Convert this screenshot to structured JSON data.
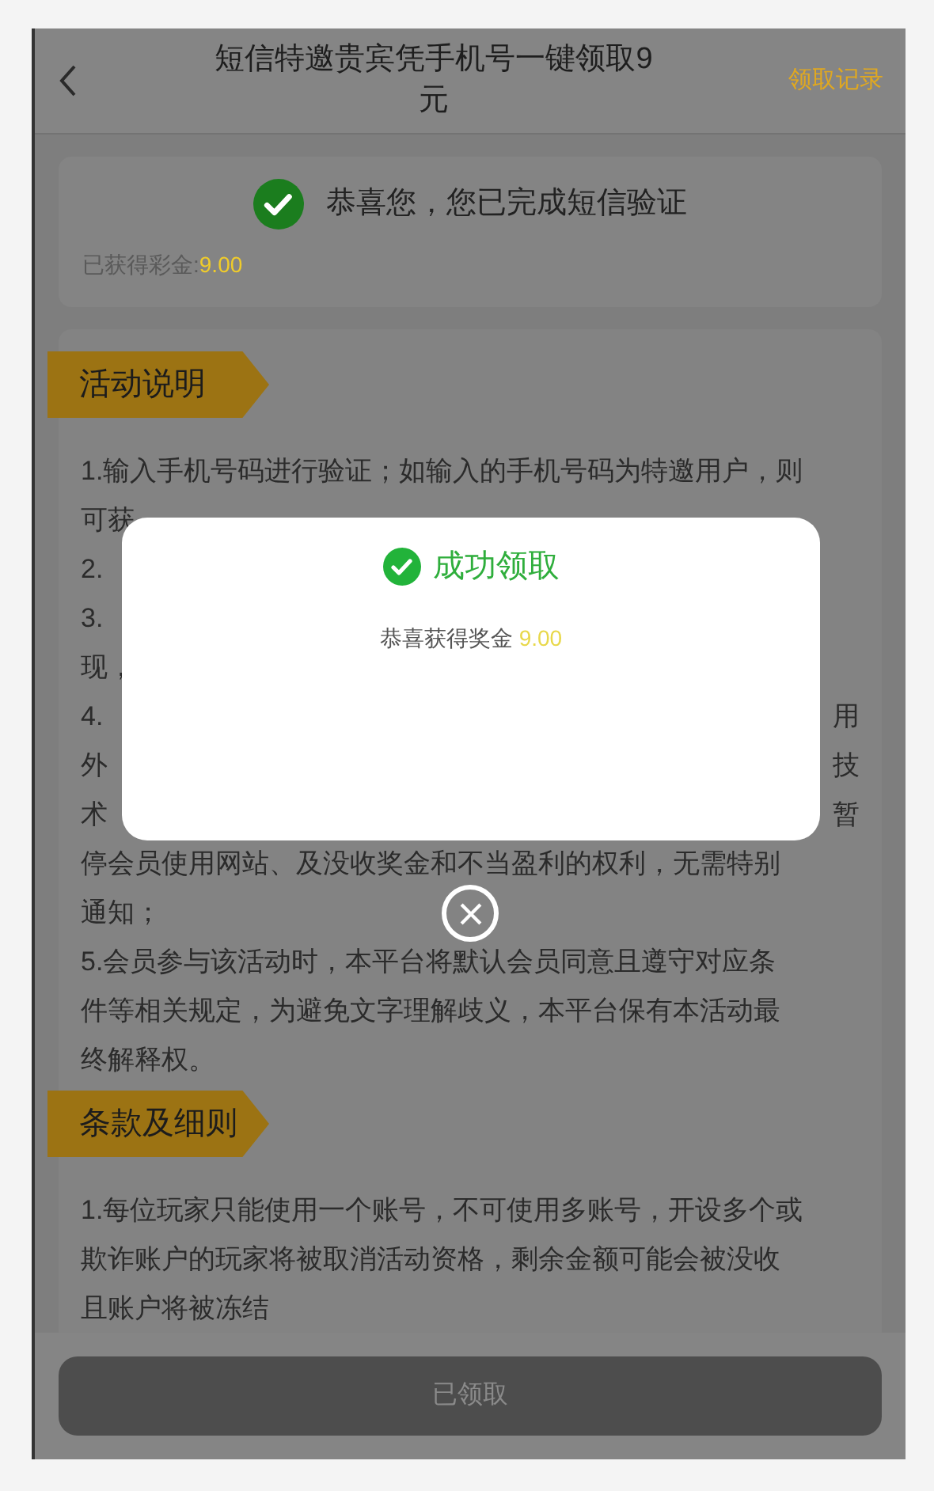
{
  "header": {
    "title": "短信特邀贵宾凭手机号一键领取9元",
    "action": "领取记录"
  },
  "status_card": {
    "message": "恭喜您，您已完成短信验证",
    "earned_label": "已获得彩金:",
    "earned_value": "9.00"
  },
  "sections": [
    {
      "title": "活动说明",
      "lines": [
        {
          "parts": [
            "1.输入手机号码进行验证；如输入的手机号码为特邀用户，则"
          ]
        },
        {
          "parts": [
            "可获"
          ]
        },
        {
          "parts": [
            "2."
          ]
        },
        {
          "parts": [
            "3."
          ]
        },
        {
          "parts": [
            "现，"
          ]
        },
        {
          "parts": [
            "4.",
            "用"
          ]
        },
        {
          "parts": [
            "外",
            "技"
          ]
        },
        {
          "parts": [
            "术",
            "暂"
          ]
        },
        {
          "parts": [
            "停会员使用网站、及没收奖金和不当盈利的权利，无需特别"
          ]
        },
        {
          "parts": [
            "通知；"
          ]
        },
        {
          "parts": [
            "5.会员参与该活动时，本平台将默认会员同意且遵守对应条"
          ]
        },
        {
          "parts": [
            "件等相关规定，为避免文字理解歧义，本平台保有本活动最"
          ]
        },
        {
          "parts": [
            "终解释权。"
          ]
        }
      ]
    },
    {
      "title": "条款及细则",
      "lines": [
        {
          "parts": [
            "1.每位玩家只能使用一个账号，不可使用多账号，开设多个或"
          ]
        },
        {
          "parts": [
            "欺诈账户的玩家将被取消活动资格，剩余金额可能会被没收"
          ]
        },
        {
          "parts": [
            "且账户将被冻结"
          ]
        }
      ]
    }
  ],
  "claim_button": {
    "label": "已领取",
    "disabled": true
  },
  "modal": {
    "title": "成功领取",
    "message": "恭喜获得奖金",
    "amount": "9.00"
  }
}
